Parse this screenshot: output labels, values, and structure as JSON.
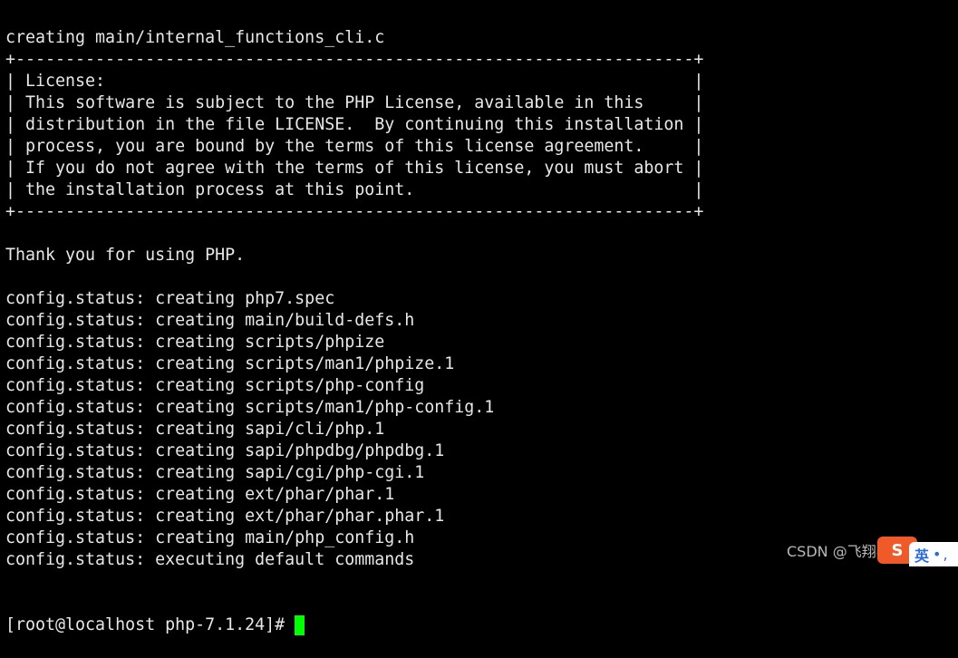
{
  "terminal": {
    "lines": [
      "creating main/internal_functions_cli.c",
      "+--------------------------------------------------------------------+",
      "| License:                                                           |",
      "| This software is subject to the PHP License, available in this     |",
      "| distribution in the file LICENSE.  By continuing this installation |",
      "| process, you are bound by the terms of this license agreement.     |",
      "| If you do not agree with the terms of this license, you must abort |",
      "| the installation process at this point.                            |",
      "+--------------------------------------------------------------------+",
      "",
      "Thank you for using PHP.",
      "",
      "config.status: creating php7.spec",
      "config.status: creating main/build-defs.h",
      "config.status: creating scripts/phpize",
      "config.status: creating scripts/man1/phpize.1",
      "config.status: creating scripts/php-config",
      "config.status: creating scripts/man1/php-config.1",
      "config.status: creating sapi/cli/php.1",
      "config.status: creating sapi/phpdbg/phpdbg.1",
      "config.status: creating sapi/cgi/php-cgi.1",
      "config.status: creating ext/phar/phar.1",
      "config.status: creating ext/phar/phar.phar.1",
      "config.status: creating main/php_config.h",
      "config.status: executing default commands"
    ],
    "prompt": "[root@localhost php-7.1.24]# ",
    "cursor_color": "#00ff00"
  },
  "watermark": {
    "text": "CSDN @飞翔小怪兽"
  },
  "ime": {
    "logo": "S",
    "mode": "英",
    "dots": "•,",
    "badge_color": "#f05a28"
  }
}
